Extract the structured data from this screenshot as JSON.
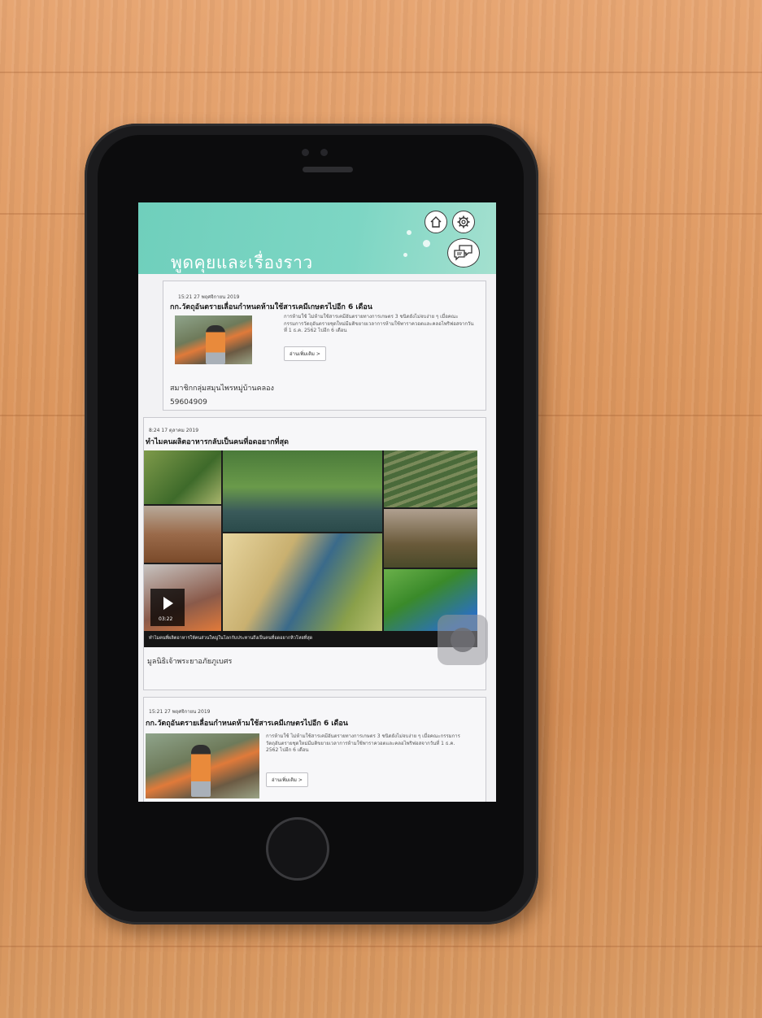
{
  "header": {
    "title": "พูดคุยและเรื่องราว",
    "home_icon": "home-icon",
    "settings_icon": "gear-icon",
    "chat_icon": "chat-bubbles-icon",
    "color": "#7dd6c4"
  },
  "feed": [
    {
      "date": "15:21 27 พฤศจิกายน 2019",
      "title": "กก.วัตถุอันตรายเลื่อนกำหนดห้ามใช้สารเคมีเกษตรไปอีก 6 เดือน",
      "excerpt": "การห้ามใช้ ไม่ห้ามใช้สารเคมีอันตรายทางการเกษตร 3 ชนิดยังไม่จบง่าย ๆ เมื่อคณะกรรมการวัตถุอันตรายชุดใหม่มีมติขยายเวลาการห้ามใช้พาราควอตและคลอไพริฟอสจากวันที่ 1 ธ.ค. 2562 ไปอีก 6 เดือน",
      "more_label": "อ่านเพิ่มเติม >",
      "author": "สมาชิกกลุ่มสมุนไพรหมู่บ้านคลอง",
      "author_id": "59604909"
    },
    {
      "date": "8:24 17 ตุลาคม 2019",
      "title": "ทำไมคนผลิตอาหารกลับเป็นคนที่อดอยากที่สุด",
      "video_caption": "ทำไมคนที่ผลิตอาหารให้คนส่วนใหญ่ในโลกกับประทานถึงเป็นคนที่อดอยากหิวโหยที่สุด",
      "video_duration": "03:22",
      "author": "มูลนิธิเจ้าพระยาอภัยภูเบศร"
    },
    {
      "date": "15:21 27 พฤศจิกายน 2019",
      "title": "กก.วัตถุอันตรายเลื่อนกำหนดห้ามใช้สารเคมีเกษตรไปอีก 6 เดือน",
      "excerpt": "การห้ามใช้ ไม่ห้ามใช้สารเคมีอันตรายทางการเกษตร 3 ชนิดยังไม่จบง่าย ๆ เมื่อคณะกรรมการวัตถุอันตรายชุดใหม่มีมติขยายเวลาการห้ามใช้พาราควอตและคลอไพริฟอสจากวันที่ 1 ธ.ค. 2562 ไปอีก 6 เดือน",
      "more_label": "อ่านเพิ่มเติม >"
    }
  ]
}
